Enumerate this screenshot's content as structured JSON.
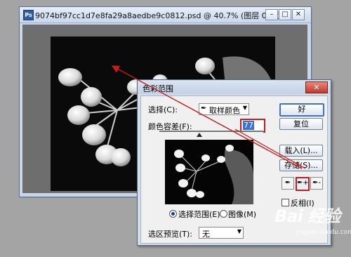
{
  "document": {
    "title": "9074bf97cc1d7e8fa29a8aedbe9c0812.psd @ 40.7% (图层 0, 蓝)",
    "app_icon": "Ps",
    "buttons": {
      "minimize": "–",
      "maximize": "□",
      "close": "✕"
    }
  },
  "dialog": {
    "title": "色彩范围",
    "close_label": "✕",
    "select_label": "选择(C):",
    "select_value": "取样颜色",
    "fuzziness_label": "颜色容差(F):",
    "fuzziness_value": "77",
    "fuzziness_level": 0.385,
    "radio_selection": "选择范围(E)",
    "radio_image": "图像(M)",
    "preview_label": "选区预览(T):",
    "preview_value": "无",
    "ok": "好",
    "reset": "复位",
    "load": "载入(L)...",
    "save": "存储(S)...",
    "invert_label": "反相(I)"
  },
  "watermark": {
    "brand": "Bai 经验",
    "url": "jingyan.baidu.com"
  },
  "colors": {
    "highlight_red": "#c31d1d",
    "accent_blue": "#3f72c5"
  },
  "icons": {
    "eyedropper": "eyedropper-icon",
    "eyedropper_plus": "eyedropper-plus-icon",
    "eyedropper_minus": "eyedropper-minus-icon"
  }
}
